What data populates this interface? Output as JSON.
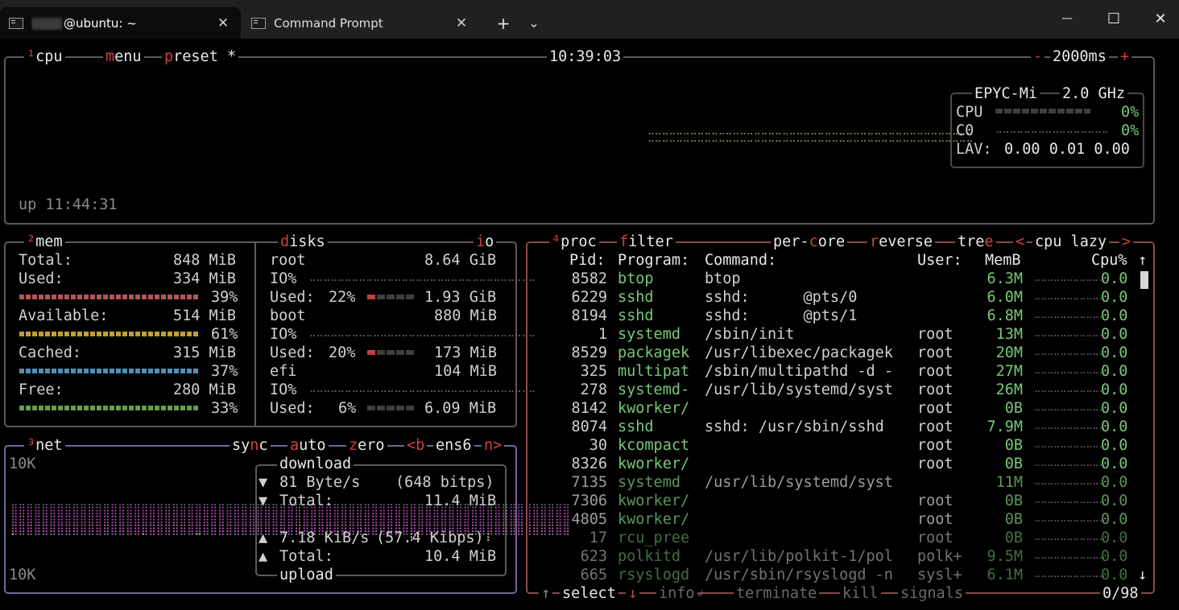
{
  "window": {
    "tabs": [
      {
        "label": "@ubuntu: ~",
        "close": "✕"
      },
      {
        "label": "Command Prompt",
        "close": "✕"
      }
    ],
    "new_tab": "+",
    "dropdown": "⌄",
    "minimize": "—",
    "maximize": "☐",
    "close": "✕"
  },
  "cpu": {
    "header_num": "¹",
    "title": "cpu",
    "menu_key": "m",
    "menu_rest": "enu",
    "preset_key": "p",
    "preset_rest": "reset *",
    "clock": "10:39:03",
    "minus": "-",
    "interval": "2000ms",
    "plus": "+",
    "model": "EPYC-Mi",
    "freq": "2.0 GHz",
    "rows": [
      {
        "label": "CPU",
        "pct": "0%"
      },
      {
        "label": "C0",
        "pct": "0%"
      }
    ],
    "lav_label": "LAV:",
    "lav": "0.00 0.01 0.00",
    "uptime": "up 11:44:31"
  },
  "mem": {
    "header_num": "²",
    "title": "mem",
    "rows": [
      {
        "label": "Total:",
        "value": "848 MiB",
        "pct": ""
      },
      {
        "label": "Used:",
        "value": "334 MiB",
        "pct": "39%",
        "color": "#c86060",
        "fill": 0.39
      },
      {
        "label": "Available:",
        "value": "514 MiB",
        "pct": "61%",
        "color": "#d8b040",
        "fill": 0.61
      },
      {
        "label": "Cached:",
        "value": "315 MiB",
        "pct": "37%",
        "color": "#5aa0c8",
        "fill": 0.37
      },
      {
        "label": "Free:",
        "value": "280 MiB",
        "pct": "33%",
        "color": "#70b050",
        "fill": 0.33
      }
    ]
  },
  "disks": {
    "d_key": "d",
    "title_rest": "isks",
    "io_i": "i",
    "io_rest": "o",
    "entries": [
      {
        "name": "root",
        "size": "8.64 GiB",
        "io": "IO%",
        "used_label": "Used:",
        "used_pct": "22%",
        "used_val": "1.93 GiB"
      },
      {
        "name": "boot",
        "size": "880 MiB",
        "io": "IO%",
        "used_label": "Used:",
        "used_pct": "20%",
        "used_val": "173 MiB"
      },
      {
        "name": "efi",
        "size": "104 MiB",
        "io": "IO%",
        "used_label": "Used:",
        "used_pct": "6%",
        "used_val": "6.09 MiB"
      }
    ]
  },
  "net": {
    "header_num": "³",
    "title": "net",
    "sync_a": "sy",
    "sync_key": "n",
    "sync_b": "c",
    "auto_key": "a",
    "auto_rest": "uto",
    "zero_key": "z",
    "zero_rest": "ero",
    "prev": "<b",
    "iface": "ens6",
    "next": "n>",
    "scale_top": "10K",
    "scale_bottom": "10K",
    "download_label": "download",
    "download_rate": "81 Byte/s",
    "download_bits": "(648 bitps)",
    "download_total_label": "Total:",
    "download_total": "11.4 MiB",
    "upload_rate": "7.18 KiB/s",
    "upload_bits": "(57.4 Kibps)",
    "upload_total_label": "Total:",
    "upload_total": "10.4 MiB",
    "upload_label": "upload",
    "down_arrow": "▼",
    "up_arrow": "▲"
  },
  "proc": {
    "header_num": "⁴",
    "title": "proc",
    "filter_key": "f",
    "filter_rest": "ilter",
    "percore_a": "per-",
    "percore_key": "c",
    "percore_b": "ore",
    "reverse_key": "r",
    "reverse_rest": "everse",
    "tree_a": "tre",
    "tree_key": "e",
    "sort_prev": "<",
    "sort": "cpu lazy",
    "sort_next": ">",
    "columns": {
      "pid": "Pid:",
      "program": "Program:",
      "command": "Command:",
      "user": "User:",
      "mem": "MemB",
      "cpu": "Cpu%"
    },
    "rows": [
      {
        "pid": "8582",
        "program": "btop",
        "command": "btop",
        "user": "",
        "mem": "6.3M",
        "cpu": "0.0"
      },
      {
        "pid": "6229",
        "program": "sshd",
        "command": "sshd:      @pts/0",
        "user": "",
        "mem": "6.0M",
        "cpu": "0.0"
      },
      {
        "pid": "8194",
        "program": "sshd",
        "command": "sshd:      @pts/1",
        "user": "",
        "mem": "6.8M",
        "cpu": "0.0"
      },
      {
        "pid": "1",
        "program": "systemd",
        "command": "/sbin/init",
        "user": "root",
        "mem": "13M",
        "cpu": "0.0"
      },
      {
        "pid": "8529",
        "program": "packagek",
        "command": "/usr/libexec/packagek",
        "user": "root",
        "mem": "20M",
        "cpu": "0.0"
      },
      {
        "pid": "325",
        "program": "multipat",
        "command": "/sbin/multipathd -d -",
        "user": "root",
        "mem": "27M",
        "cpu": "0.0"
      },
      {
        "pid": "278",
        "program": "systemd-",
        "command": "/usr/lib/systemd/syst",
        "user": "root",
        "mem": "26M",
        "cpu": "0.0"
      },
      {
        "pid": "8142",
        "program": "kworker/",
        "command": "",
        "user": "root",
        "mem": "0B",
        "cpu": "0.0"
      },
      {
        "pid": "8074",
        "program": "sshd",
        "command": "sshd: /usr/sbin/sshd",
        "user": "root",
        "mem": "7.9M",
        "cpu": "0.0"
      },
      {
        "pid": "30",
        "program": "kcompact",
        "command": "",
        "user": "root",
        "mem": "0B",
        "cpu": "0.0"
      },
      {
        "pid": "8326",
        "program": "kworker/",
        "command": "",
        "user": "root",
        "mem": "0B",
        "cpu": "0.0"
      },
      {
        "pid": "7135",
        "program": "systemd",
        "command": "/usr/lib/systemd/syst",
        "user": "",
        "mem": "11M",
        "cpu": "0.0"
      },
      {
        "pid": "7306",
        "program": "kworker/",
        "command": "",
        "user": "root",
        "mem": "0B",
        "cpu": "0.0"
      },
      {
        "pid": "4805",
        "program": "kworker/",
        "command": "",
        "user": "root",
        "mem": "0B",
        "cpu": "0.0"
      },
      {
        "pid": "17",
        "program": "rcu_pree",
        "command": "",
        "user": "root",
        "mem": "0B",
        "cpu": "0.0"
      },
      {
        "pid": "623",
        "program": "polkitd",
        "command": "/usr/lib/polkit-1/pol",
        "user": "polk+",
        "mem": "9.5M",
        "cpu": "0.0"
      },
      {
        "pid": "665",
        "program": "rsyslogd",
        "command": "/usr/sbin/rsyslogd -n",
        "user": "sysl+",
        "mem": "6.1M",
        "cpu": "0.0"
      }
    ],
    "scroll_up": "↑",
    "scroll_down": "↓",
    "footer": {
      "up": "↑",
      "select": "select",
      "down": "↓",
      "info": "info",
      "enter": "↲",
      "terminate": "terminate",
      "kill": "kill",
      "signals": "signals",
      "count": "0/98"
    }
  }
}
